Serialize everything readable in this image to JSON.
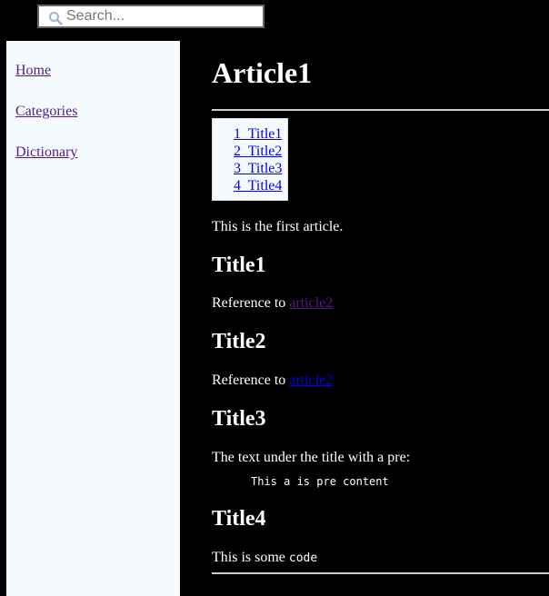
{
  "search": {
    "placeholder": "Search...",
    "value": "",
    "icon": "search-icon"
  },
  "sidebar": {
    "items": [
      {
        "label": "Home"
      },
      {
        "label": "Categories"
      },
      {
        "label": "Dictionary"
      }
    ]
  },
  "article": {
    "title": "Article1",
    "toc": [
      {
        "label": "1  Title1"
      },
      {
        "label": "2  Title2"
      },
      {
        "label": "3  Title3"
      },
      {
        "label": "4  Title4"
      }
    ],
    "intro": "This is the first article.",
    "sections": [
      {
        "title": "Title1",
        "text": "Reference to ",
        "link": "article2"
      },
      {
        "title": "Title2",
        "text": "Reference to ",
        "link": "article2"
      },
      {
        "title": "Title3",
        "text": "The text under the title with a pre:",
        "pre": "This a is pre content"
      },
      {
        "title": "Title4",
        "text": "This is some ",
        "code": "code"
      }
    ]
  },
  "colors": {
    "background": "#000000",
    "sidebar": "#f5faff",
    "link": "#0000ee",
    "visited_link": "#551a8b"
  }
}
